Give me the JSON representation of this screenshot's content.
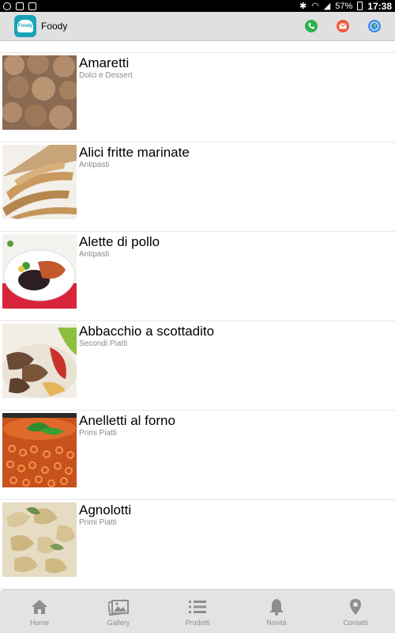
{
  "status": {
    "battery": "57%",
    "time": "17:38"
  },
  "header": {
    "app_name": "Foody",
    "logo_text": "Foody",
    "actions": [
      "phone-icon",
      "mail-icon",
      "globe-icon"
    ]
  },
  "recipes": [
    {
      "title": "Amaretti",
      "category": "Dolci e Dessert"
    },
    {
      "title": "Alici fritte marinate",
      "category": "Antipasti"
    },
    {
      "title": "Alette di pollo",
      "category": "Antipasti"
    },
    {
      "title": "Abbacchio a scottadito",
      "category": "Secondi Piatti"
    },
    {
      "title": "Anelletti al forno",
      "category": "Primi Piatti"
    },
    {
      "title": "Agnolotti",
      "category": "Primi Piatti"
    }
  ],
  "nav": [
    {
      "label": "Home",
      "icon": "home-icon"
    },
    {
      "label": "Gallery",
      "icon": "gallery-icon"
    },
    {
      "label": "Prodotti",
      "icon": "list-icon"
    },
    {
      "label": "Novità",
      "icon": "bell-icon"
    },
    {
      "label": "Contatti",
      "icon": "location-pin-icon"
    }
  ],
  "colors": {
    "appbar": "#e0e0e0",
    "logo": "#18a4b6",
    "phone": "#2bb24c",
    "mail": "#ef5a3a",
    "web": "#3a8ee6",
    "nav_text": "#8e8e8e"
  }
}
